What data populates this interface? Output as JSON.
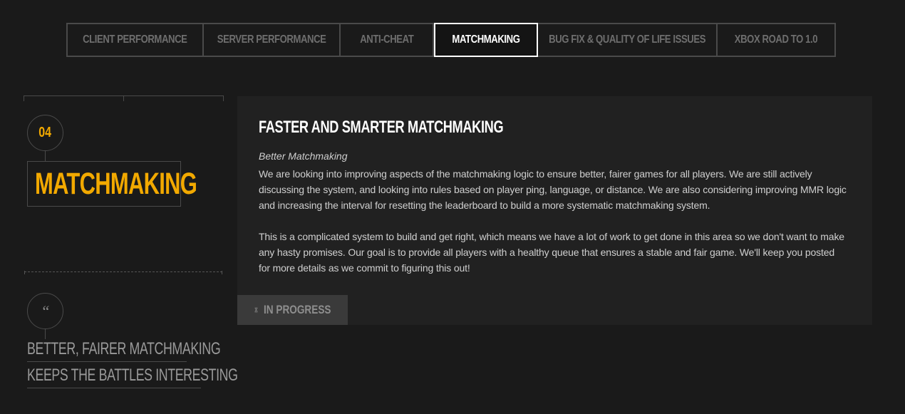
{
  "tabs": [
    {
      "label": "CLIENT PERFORMANCE",
      "active": false
    },
    {
      "label": "SERVER PERFORMANCE",
      "active": false
    },
    {
      "label": "ANTI-CHEAT",
      "active": false
    },
    {
      "label": "MATCHMAKING",
      "active": true
    },
    {
      "label": "BUG FIX & QUALITY OF LIFE ISSUES",
      "active": false
    },
    {
      "label": "XBOX ROAD TO 1.0",
      "active": false
    }
  ],
  "section": {
    "number": "04",
    "title": "MATCHMAKING",
    "quote_mark": "“",
    "quote_lines": [
      "BETTER, FAIRER MATCHMAKING",
      "KEEPS THE BATTLES INTERESTING"
    ]
  },
  "panel": {
    "title": "FASTER AND SMARTER MATCHMAKING",
    "subhead": "Better Matchmaking",
    "paragraphs": [
      "We are looking into improving aspects of the matchmaking logic to ensure better, fairer games for all players. We are still actively discussing the system, and looking into rules based on player ping, language, or distance. We are also considering improving MMR logic and increasing the interval for resetting the leaderboard to build a more systematic matchmaking system.",
      "This is a complicated system to build and get right, which means we have a lot of work to get done in this area so we don't want to make any hasty promises. Our goal is to provide all players with a healthy queue that ensures a stable and fair game. We'll keep you posted for more details as we commit to figuring this out!"
    ],
    "status": {
      "icon": "hourglass-icon",
      "label": "IN PROGRESS"
    }
  },
  "colors": {
    "accent": "#f2a900",
    "background": "#1a1a1a",
    "panel": "#212121",
    "border": "#4a4a4a"
  }
}
